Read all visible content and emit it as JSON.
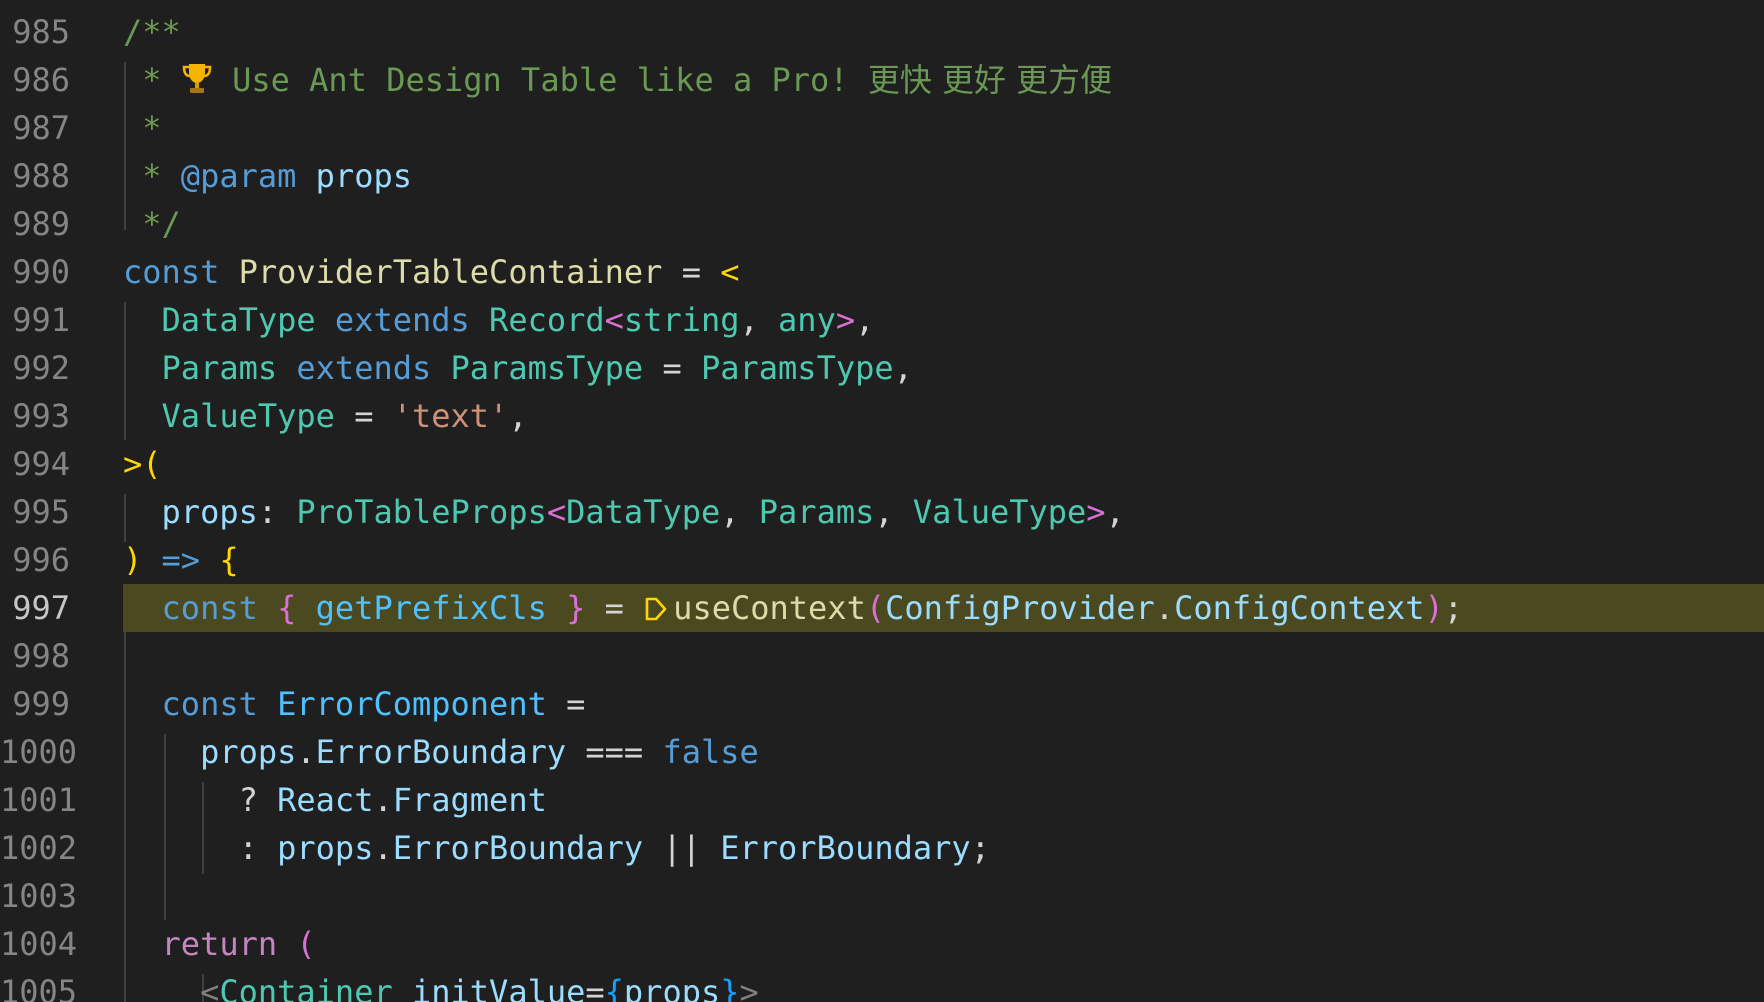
{
  "editor": {
    "current_line": "997",
    "lines": [
      {
        "n": "985",
        "t": [
          "/**"
        ]
      },
      {
        "n": "986",
        "t": [
          " * ",
          " Use Ant Design Table like a Pro! ",
          "更快 更好 更方便"
        ]
      },
      {
        "n": "987",
        "t": [
          " *"
        ]
      },
      {
        "n": "988",
        "t": [
          " * ",
          "@param",
          " ",
          "props"
        ]
      },
      {
        "n": "989",
        "t": [
          " */"
        ]
      },
      {
        "n": "990",
        "t": [
          "const",
          " ",
          "ProviderTableContainer",
          " = ",
          "<"
        ]
      },
      {
        "n": "991",
        "t": [
          "  ",
          "DataType",
          " ",
          "extends",
          " ",
          "Record",
          "<",
          "string",
          ", ",
          "any",
          ">",
          ","
        ]
      },
      {
        "n": "992",
        "t": [
          "  ",
          "Params",
          " ",
          "extends",
          " ",
          "ParamsType",
          " = ",
          "ParamsType",
          ","
        ]
      },
      {
        "n": "993",
        "t": [
          "  ",
          "ValueType",
          " = ",
          "'text'",
          ","
        ]
      },
      {
        "n": "994",
        "t": [
          ">",
          "("
        ]
      },
      {
        "n": "995",
        "t": [
          "  ",
          "props",
          ": ",
          "ProTableProps",
          "<",
          "DataType",
          ", ",
          "Params",
          ", ",
          "ValueType",
          ">",
          ","
        ]
      },
      {
        "n": "996",
        "t": [
          ")",
          " ",
          "=>",
          " ",
          "{"
        ]
      },
      {
        "n": "997",
        "t": [
          "  ",
          "const",
          " ",
          "{",
          " ",
          "getPrefixCls",
          " ",
          "}",
          " = ",
          "useContext",
          "(",
          "ConfigProvider",
          ".",
          "ConfigContext",
          ")",
          ";"
        ]
      },
      {
        "n": "998",
        "t": [
          ""
        ]
      },
      {
        "n": "999",
        "t": [
          "  ",
          "const",
          " ",
          "ErrorComponent",
          " ="
        ]
      },
      {
        "n": "1000",
        "t": [
          "    ",
          "props",
          ".",
          "ErrorBoundary",
          " === ",
          "false"
        ]
      },
      {
        "n": "1001",
        "t": [
          "      ",
          "? ",
          "React",
          ".",
          "Fragment"
        ]
      },
      {
        "n": "1002",
        "t": [
          "      ",
          ": ",
          "props",
          ".",
          "ErrorBoundary",
          " || ",
          "ErrorBoundary",
          ";"
        ]
      },
      {
        "n": "1003",
        "t": [
          ""
        ]
      },
      {
        "n": "1004",
        "t": [
          "  ",
          "return",
          " ",
          "("
        ]
      },
      {
        "n": "1005",
        "t": [
          "    ",
          "<",
          "Container",
          " ",
          "initValue",
          "=",
          "{",
          "props",
          "}",
          ">"
        ]
      }
    ]
  },
  "icons": {
    "trophy": "trophy-icon",
    "codelens": "context-codelens-icon"
  },
  "colors": {
    "background": "#1f1f1f",
    "current_line_highlight": "#4b4920",
    "comment": "#6a9955",
    "keyword": "#569cd6",
    "type": "#4ec9b0",
    "variable": "#9cdcfe",
    "function": "#dcdcaa",
    "string": "#ce9178",
    "control": "#c586c0",
    "bracket_1": "#ffd700",
    "bracket_2": "#da70d6",
    "bracket_3": "#179fff"
  }
}
